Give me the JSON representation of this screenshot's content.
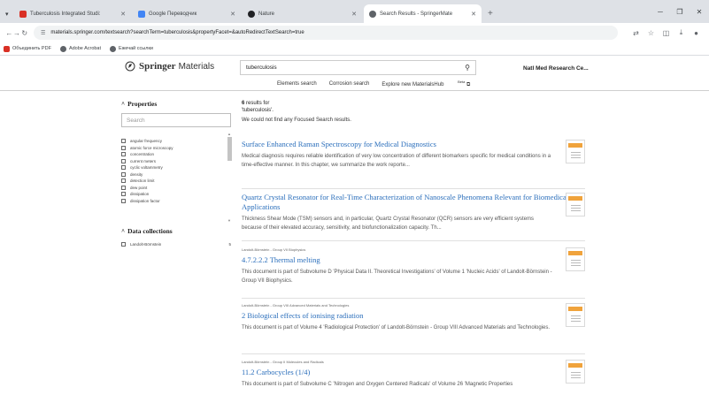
{
  "browser": {
    "tabs": [
      {
        "label": "Tuberculosis Integrated Studi:",
        "icon_color": "#d93025"
      },
      {
        "label": "Google Переводчик",
        "icon_color": "#4285f4"
      },
      {
        "label": "Nature",
        "icon_color": "#202124"
      },
      {
        "label": "Search Results - SpringerMate",
        "icon_color": "#5f6368"
      }
    ],
    "new_tab": "+",
    "url": "materials.springer.com/textsearch?searchTerm=tuberculosis&propertyFacet=&autoRedirectTextSearch=true",
    "bookmarks": [
      {
        "label": "Объединить PDF",
        "icon_color": "#d93025"
      },
      {
        "label": "Adobe Acrobat",
        "icon_color": "#5f6368"
      },
      {
        "label": "Ежечай ссылки",
        "icon_color": "#5f6368"
      }
    ]
  },
  "header": {
    "logo_word1": "Springer",
    "logo_word2": "Materials",
    "search_value": "tuberculosis",
    "institution": "Natl Med Research Ce...",
    "links": [
      "Elements search",
      "Corrosion search",
      "Explore new MaterialsHub"
    ],
    "beta": "Beta"
  },
  "filters": {
    "properties_title": "Properties",
    "search_placeholder": "Search",
    "properties": [
      "angular frequency",
      "atomic force microscopy",
      "concentration",
      "current meters",
      "cyclic voltammetry",
      "density",
      "detection limit",
      "dew point",
      "dissipation",
      "dissipation factor"
    ],
    "collections_title": "Data collections",
    "collections": [
      {
        "label": "Landolt-Börnstein",
        "count": "5"
      }
    ]
  },
  "results": {
    "count": "6",
    "results_for": "results for",
    "query": "'tuberculosis'.",
    "no_focused": "We could not find any Focused Search results.",
    "items": [
      {
        "meta": "",
        "title": "Surface Enhanced Raman Spectroscopy for Medical Diagnostics",
        "desc": "Medical diagnosis requires reliable identification of very low concentration of different biomarkers specific for medical conditions in a time-effective manner. In this chapter, we summarize the work reporte..."
      },
      {
        "meta": "",
        "title": "Quartz Crystal Resonator for Real-Time Characterization of Nanoscale Phenomena Relevant for Biomedical Applications",
        "desc": "Thickness Shear Mode (TSM) sensors and, in particular, Quartz Crystal Resonator (QCR) sensors are very efficient systems because of their elevated accuracy, sensitivity, and biofunctionalization capacity. Th..."
      },
      {
        "meta": "Landolt-Börnstein - Group VII Biophysics",
        "title": "4.7.2.2.2 Thermal melting",
        "desc": "This document is part of Subvolume D 'Physical Data II. Theoretical Investigations' of Volume 1 'Nucleic Acids' of Landolt-Börnstein - Group VII Biophysics."
      },
      {
        "meta": "Landolt-Börnstein - Group VIII Advanced Materials and Technologies",
        "title": "2 Biological effects of ionising radiation",
        "desc": "This document is part of Volume 4 'Radiological Protection' of Landolt-Börnstein - Group VIII Advanced Materials and Technologies."
      },
      {
        "meta": "Landolt-Börnstein - Group II Molecules and Radicals",
        "title": "11.2 Carbocycles (1/4)",
        "desc": "This document is part of Subvolume C 'Nitrogen and Oxygen Centered Radicals' of Volume 26 'Magnetic Properties"
      }
    ]
  }
}
